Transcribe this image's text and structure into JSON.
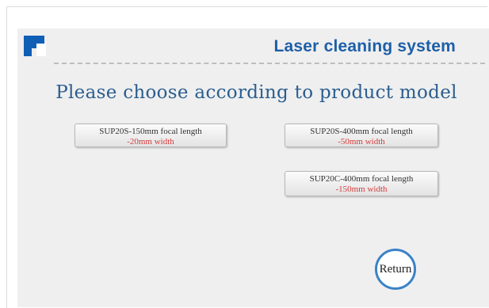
{
  "header": {
    "system_title": "Laser cleaning system"
  },
  "main": {
    "prompt": "Please choose according to product model",
    "models": [
      {
        "line1": "SUP20S-150mm focal length",
        "line2": "-20mm width"
      },
      {
        "line1": "SUP20S-400mm focal length",
        "line2": "-50mm width"
      },
      {
        "line1": "SUP20C-400mm focal length",
        "line2": "-150mm width"
      }
    ],
    "return_label": "Return"
  },
  "colors": {
    "brand_blue": "#1d5fa8",
    "accent_red": "#d43c3c",
    "panel_bg": "#efefef"
  }
}
